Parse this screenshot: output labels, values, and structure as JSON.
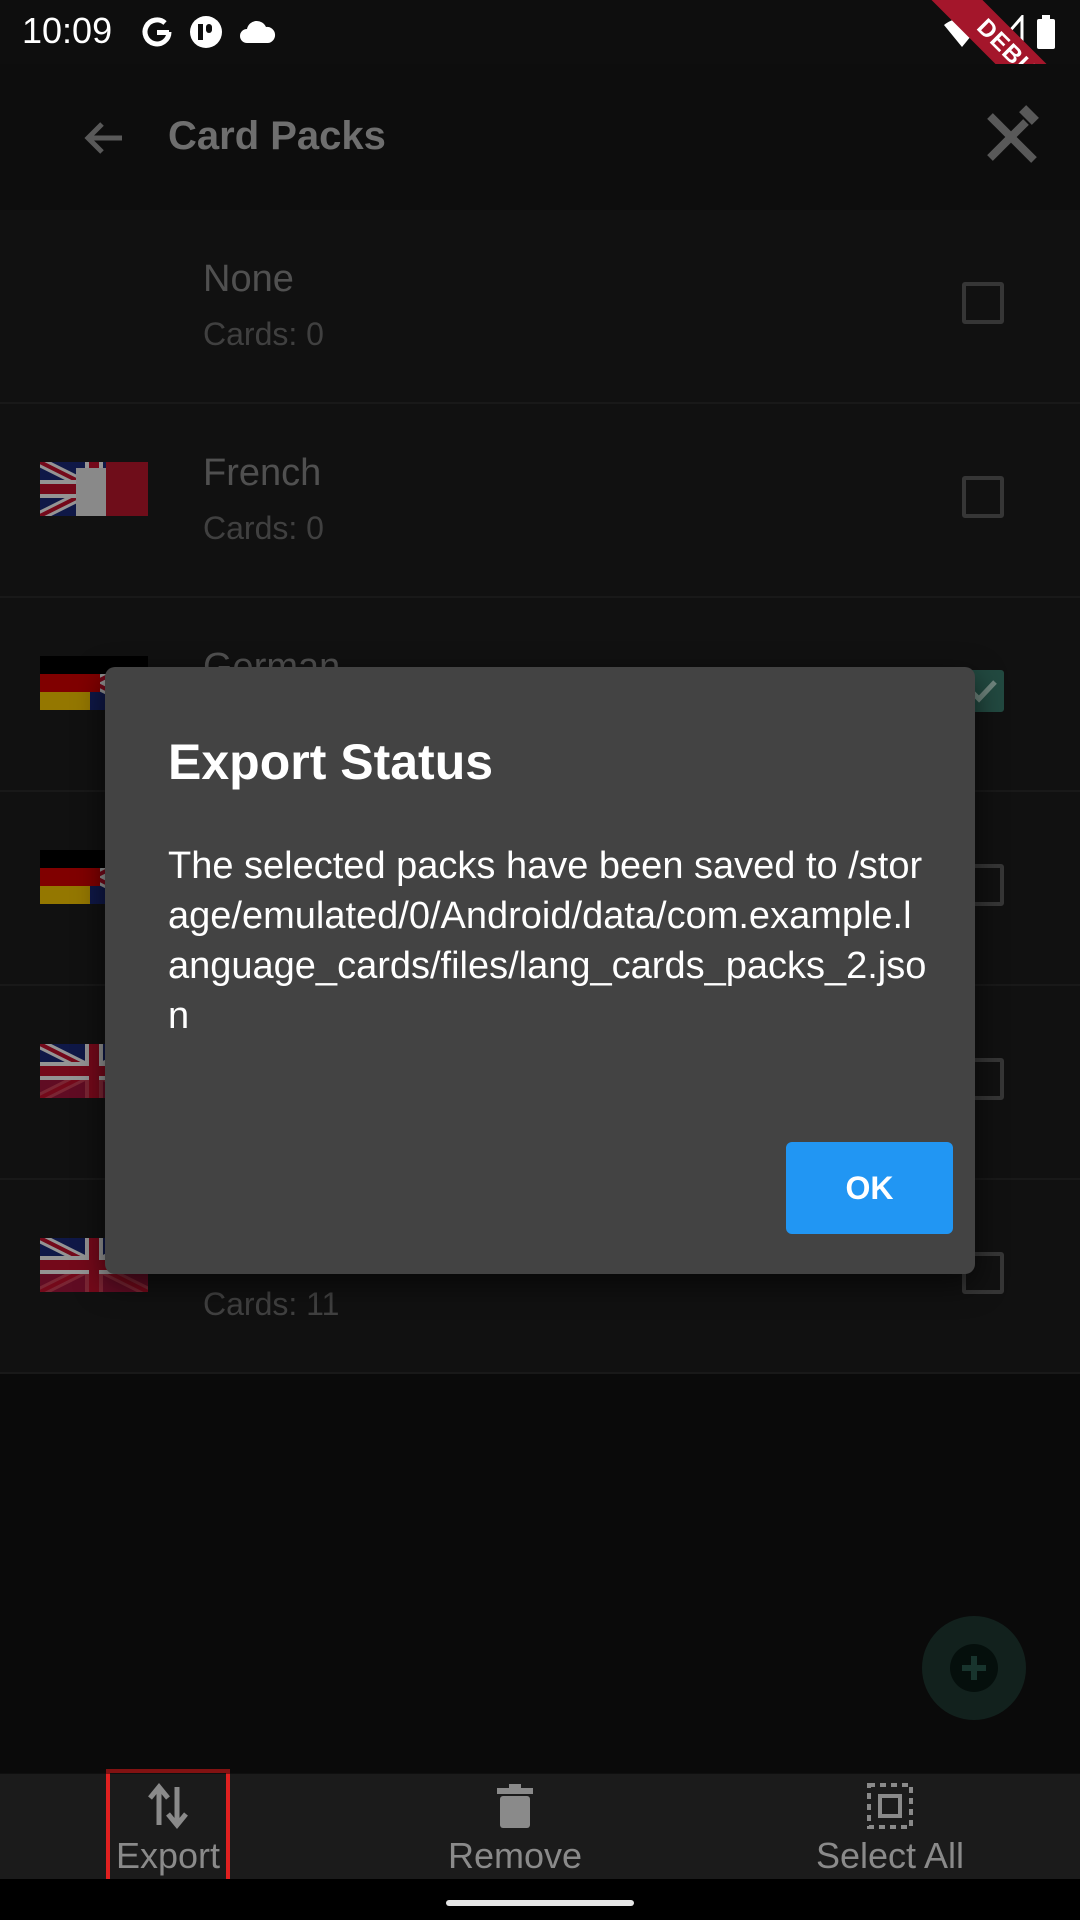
{
  "status_bar": {
    "time": "10:09",
    "debug_label": "DEBUG"
  },
  "app_bar": {
    "title": "Card Packs"
  },
  "packs": [
    {
      "title": "None",
      "subtitle": "Cards: 0",
      "checked": false,
      "flag": "none"
    },
    {
      "title": "French",
      "subtitle": "Cards: 0",
      "checked": false,
      "flag": "uk-fr"
    },
    {
      "title": "German",
      "subtitle": "",
      "checked": true,
      "flag": "de-uk"
    },
    {
      "title": "",
      "subtitle": "",
      "checked": false,
      "flag": "de-uk"
    },
    {
      "title": "",
      "subtitle": "",
      "checked": false,
      "flag": "uk-other"
    },
    {
      "title": "",
      "subtitle": "Cards: 11",
      "checked": false,
      "flag": "uk-other"
    }
  ],
  "bottom_nav": {
    "export_label": "Export",
    "remove_label": "Remove",
    "select_all_label": "Select All"
  },
  "dialog": {
    "title": "Export Status",
    "body": "The selected packs have been saved to /storage/emulated/0/Android/data/com.example.language_cards/files/lang_cards_packs_2.json",
    "ok_label": "OK"
  },
  "colors": {
    "accent": "#2196f3",
    "checkbox_checked": "#3c7f6e",
    "debug_banner": "#a4162b"
  }
}
